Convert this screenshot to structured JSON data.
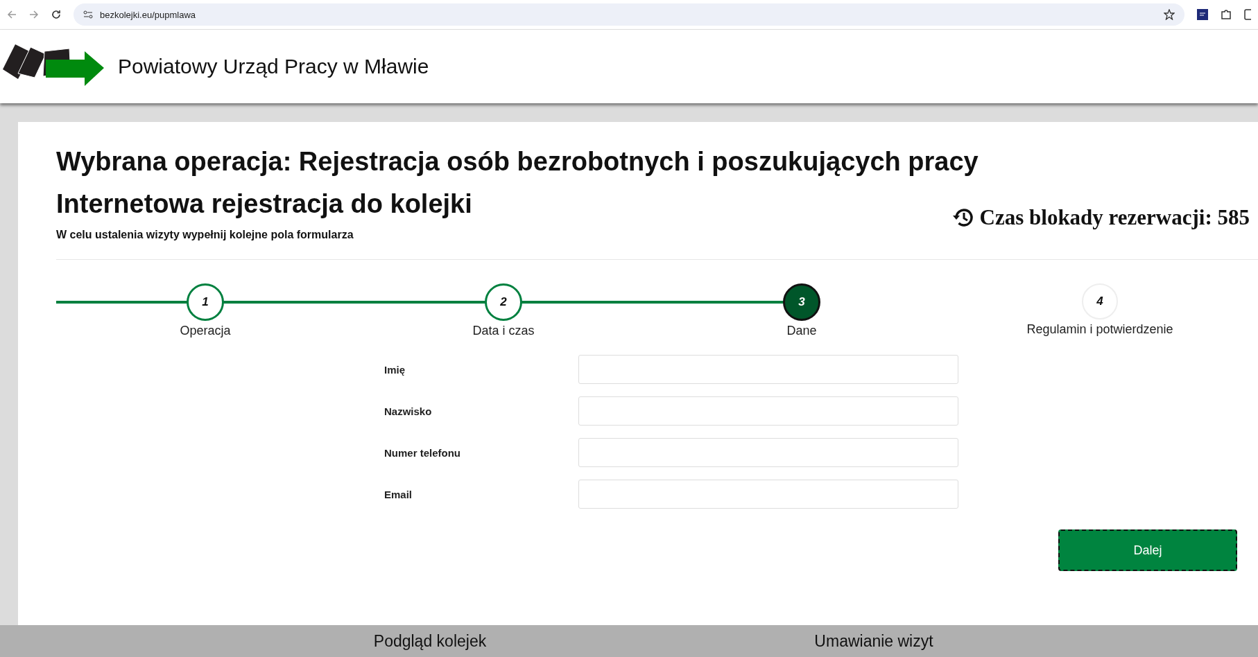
{
  "browser": {
    "url": "bezkolejki.eu/pupmlawa"
  },
  "header": {
    "title": "Powiatowy Urząd Pracy w Mławie"
  },
  "page": {
    "title": "Wybrana operacja: Rejestracja osób bezrobotnych i poszukujących pracy",
    "subtitle": "Internetowa rejestracja do kolejki",
    "instruction": "W celu ustalenia wizyty wypełnij kolejne pola formularza",
    "timer": "Czas blokady rezerwacji: 585"
  },
  "steps": [
    {
      "number": "1",
      "label": "Operacja",
      "completed": true,
      "selected": false
    },
    {
      "number": "2",
      "label": "Data i czas",
      "completed": true,
      "selected": false
    },
    {
      "number": "3",
      "label": "Dane",
      "completed": false,
      "selected": true
    },
    {
      "number": "4",
      "label": "Regulamin i potwierdzenie",
      "completed": false,
      "selected": false
    }
  ],
  "form": [
    {
      "label": "Imię"
    },
    {
      "label": "Nazwisko"
    },
    {
      "label": "Numer telefonu"
    },
    {
      "label": "Email"
    }
  ],
  "next_button": "Dalej",
  "footer": [
    "Podgląd kolejek",
    "Umawianie wizyt"
  ]
}
